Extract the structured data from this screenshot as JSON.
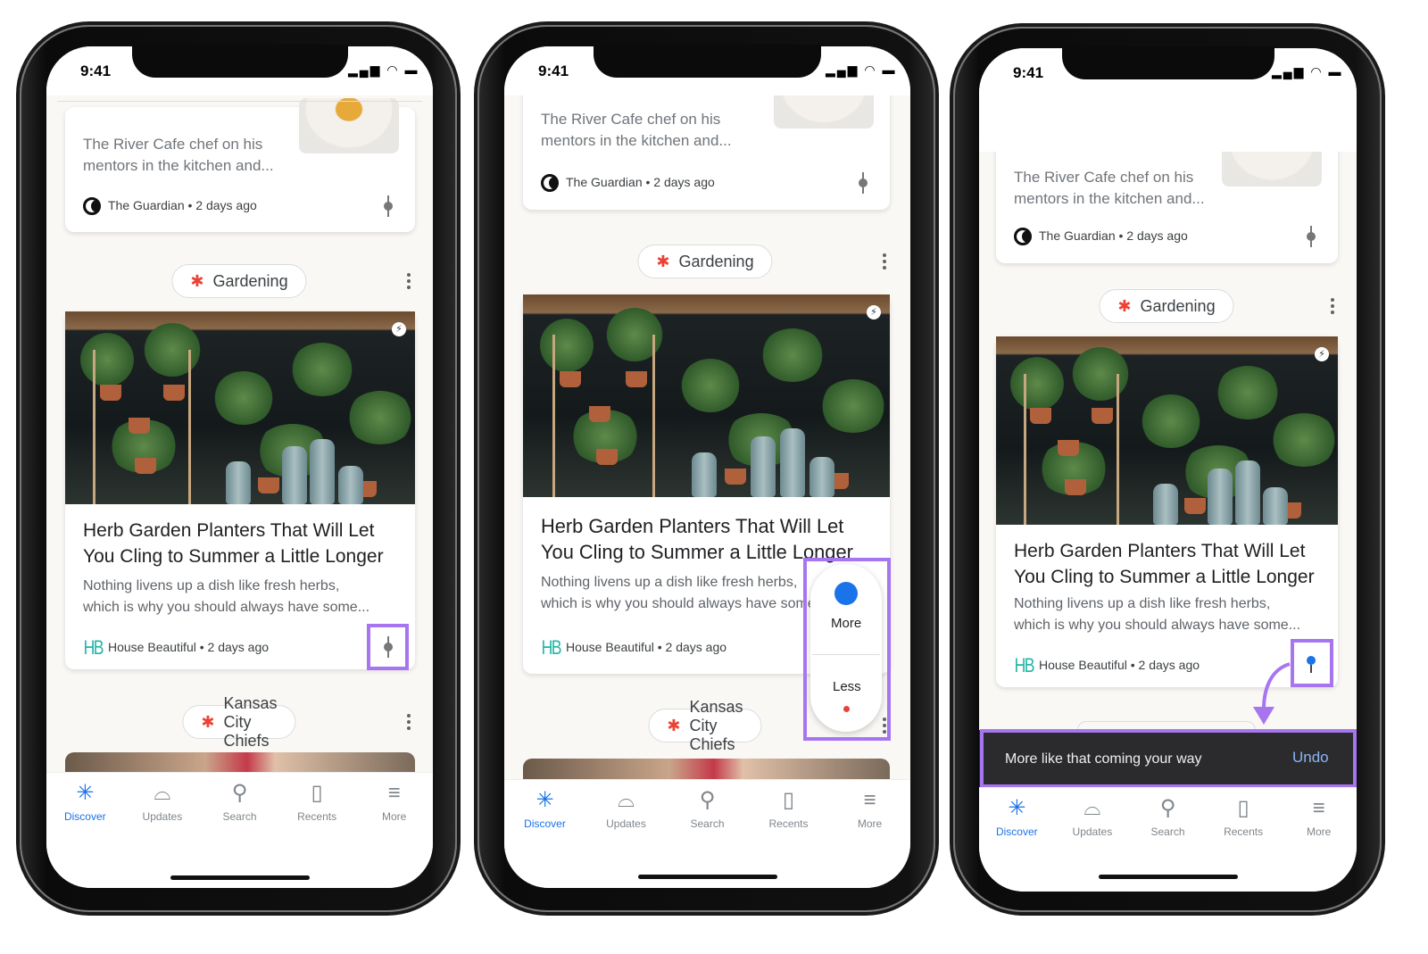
{
  "accent_color": "#1a73e8",
  "highlight_color": "#a775f0",
  "phones": [
    {
      "status": {
        "time": "9:41"
      },
      "top_card": {
        "snippet_line1": "The River Cafe chef on his",
        "snippet_line2": "mentors in the kitchen and...",
        "source": "The Guardian • 2 days ago"
      },
      "topic_chip": "Gardening",
      "article": {
        "title_line1": "Herb Garden Planters That Will Let",
        "title_line2": "You Cling to Summer a Little Longer",
        "desc_line1": "Nothing livens up a dish like fresh herbs,",
        "desc_line2": "which is why you should always have some...",
        "source_logo": "HB",
        "source": "House Beautiful • 2 days ago"
      },
      "next_chip": "Kansas City Chiefs",
      "nav": [
        "Discover",
        "Updates",
        "Search",
        "Recents",
        "More"
      ]
    },
    {
      "status": {
        "time": "9:41"
      },
      "top_card": {
        "snippet_line1": "The River Cafe chef on his",
        "snippet_line2": "mentors in the kitchen and...",
        "source": "The Guardian • 2 days ago"
      },
      "topic_chip": "Gardening",
      "article": {
        "title_line1": "Herb Garden Planters That Will Let",
        "title_line2": "You Cling to Summer a Little Longer",
        "desc_line1": "Nothing livens up a dish like fresh herbs,",
        "desc_line2": "which is why you should always have some...",
        "source_logo": "HB",
        "source": "House Beautiful • 2 days ago"
      },
      "next_chip": "Kansas City Chiefs",
      "feedback_popup": {
        "more": "More",
        "less": "Less"
      },
      "nav": [
        "Discover",
        "Updates",
        "Search",
        "Recents",
        "More"
      ]
    },
    {
      "status": {
        "time": "9:41"
      },
      "top_card": {
        "snippet_line1": "The River Cafe chef on his",
        "snippet_line2": "mentors in the kitchen and...",
        "source": "The Guardian • 2 days ago"
      },
      "topic_chip": "Gardening",
      "article": {
        "title_line1": "Herb Garden Planters That Will Let",
        "title_line2": "You Cling to Summer a Little Longer",
        "desc_line1": "Nothing livens up a dish like fresh herbs,",
        "desc_line2": "which is why you should always have some...",
        "source_logo": "HB",
        "source": "House Beautiful • 2 days ago"
      },
      "snackbar": {
        "message": "More like that coming your way",
        "action": "Undo"
      },
      "nav": [
        "Discover",
        "Updates",
        "Search",
        "Recents",
        "More"
      ]
    }
  ]
}
